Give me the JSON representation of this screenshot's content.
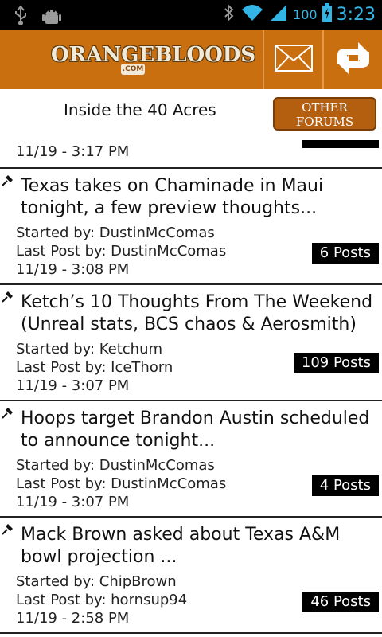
{
  "status_bar": {
    "battery": "100",
    "time": "3:23"
  },
  "header": {
    "logo_text": "ORANGEBLOODS",
    "logo_sub": ".COM"
  },
  "subheader": {
    "title": "Inside the 40 Acres",
    "other_forums_line1": "OTHER",
    "other_forums_line2": "FORUMS"
  },
  "partial_row": {
    "date": "11/19 - 3:17 PM"
  },
  "threads": [
    {
      "title_line1": "Texas takes on Chaminade in Maui",
      "title_line2": "tonight, a few preview thoughts...",
      "started_by": "Started by: DustinMcComas",
      "last_post_by": "Last Post by: DustinMcComas",
      "date": "11/19 - 3:08 PM",
      "posts": "6 Posts"
    },
    {
      "title_line1": "Ketch’s 10 Thoughts From The Weekend",
      "title_line2": "(Unreal stats, BCS chaos & Aerosmith)",
      "started_by": "Started by: Ketchum",
      "last_post_by": "Last Post by: IceThorn",
      "date": "11/19 - 3:07 PM",
      "posts": "109 Posts"
    },
    {
      "title_line1": "Hoops target Brandon Austin scheduled",
      "title_line2": "to announce tonight...",
      "started_by": "Started by: DustinMcComas",
      "last_post_by": "Last Post by: DustinMcComas",
      "date": "11/19 - 3:07 PM",
      "posts": "4 Posts"
    },
    {
      "title_line1": "Mack Brown asked about Texas A&M",
      "title_line2": "bowl projection ...",
      "started_by": "Started by: ChipBrown",
      "last_post_by": "Last Post by: hornsup94",
      "date": "11/19 - 2:58 PM",
      "posts": "46 Posts"
    }
  ],
  "colors": {
    "brand_orange": "#c96f0f",
    "time_blue": "#33b5e5"
  },
  "icons": [
    "usb-icon",
    "android-debug-icon",
    "bluetooth-icon",
    "wifi-icon",
    "signal-icon",
    "battery-icon",
    "mail-icon",
    "refresh-icon",
    "pin-icon"
  ]
}
